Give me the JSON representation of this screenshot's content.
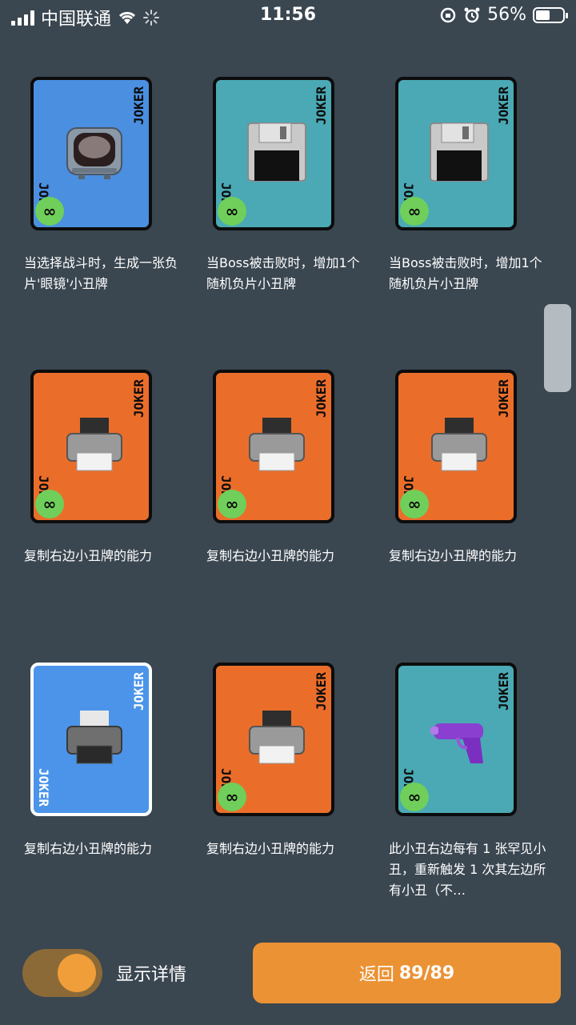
{
  "status_bar": {
    "carrier": "中国联通",
    "time": "11:56",
    "battery": "56%",
    "battery_level": 0.56
  },
  "cards": [
    {
      "color": "blue",
      "icon": "tv-icon",
      "joker": "JOKER",
      "badge": "∞",
      "desc": "当选择战斗时，生成一张负片'眼镜'小丑牌"
    },
    {
      "color": "teal",
      "icon": "floppy-disk-icon",
      "joker": "JOKER",
      "badge": "∞",
      "desc": "当Boss被击败时，增加1个随机负片小丑牌"
    },
    {
      "color": "teal",
      "icon": "floppy-disk-icon",
      "joker": "JOKER",
      "badge": "∞",
      "desc": "当Boss被击败时，增加1个随机负片小丑牌"
    },
    {
      "color": "orange",
      "icon": "printer-icon",
      "joker": "JOKER",
      "badge": "∞",
      "desc": "复制右边小丑牌的能力"
    },
    {
      "color": "orange",
      "icon": "printer-icon",
      "joker": "JOKER",
      "badge": "∞",
      "desc": "复制右边小丑牌的能力"
    },
    {
      "color": "orange",
      "icon": "printer-icon",
      "joker": "JOKER",
      "badge": "∞",
      "desc": "复制右边小丑牌的能力"
    },
    {
      "color": "lightblue",
      "icon": "printer-icon",
      "joker": "JOKER",
      "badge": "",
      "desc": "复制右边小丑牌的能力"
    },
    {
      "color": "orange",
      "icon": "printer-icon",
      "joker": "JOKER",
      "badge": "∞",
      "desc": "复制右边小丑牌的能力"
    },
    {
      "color": "teal",
      "icon": "water-gun-icon",
      "joker": "JOKER",
      "badge": "∞",
      "desc": "此小丑右边每有 1 张罕见小丑，重新触发 1 次其左边所有小丑（不…"
    }
  ],
  "controls": {
    "toggle_label": "显示详情",
    "toggle_on": true,
    "back_label": "返回",
    "back_count": "89/89"
  }
}
